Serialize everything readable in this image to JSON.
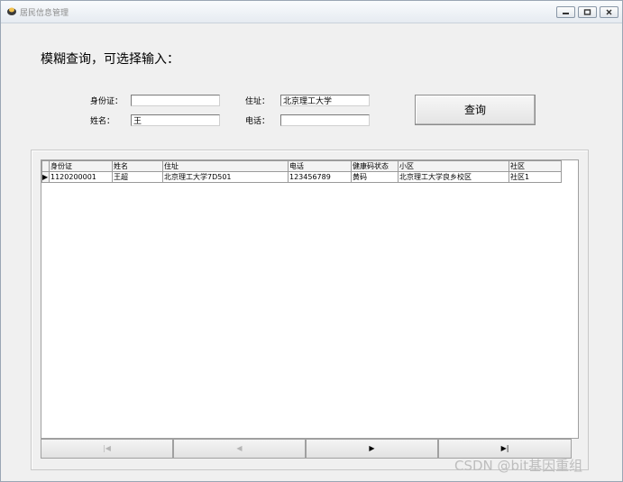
{
  "window": {
    "title": "居民信息管理"
  },
  "form": {
    "heading": "模糊查询，可选择输入：",
    "id_label": "身份证：",
    "id_value": "",
    "name_label": "姓名：",
    "name_value": "王",
    "address_label": "住址：",
    "address_value": "北京理工大学",
    "phone_label": "电话：",
    "phone_value": "",
    "query_button": "查询"
  },
  "grid": {
    "columns": [
      "身份证",
      "姓名",
      "住址",
      "电话",
      "健康码状态",
      "小区",
      "社区"
    ],
    "rows": [
      [
        "1120200001",
        "王超",
        "北京理工大学7D501",
        "123456789",
        "黄码",
        "北京理工大学良乡校区",
        "社区1"
      ]
    ],
    "current_row_marker": "▶"
  },
  "navigator": {
    "first": "|◀",
    "prev": "◀",
    "next": "▶",
    "last": "▶|"
  },
  "watermark": "CSDN @bit基因重组"
}
